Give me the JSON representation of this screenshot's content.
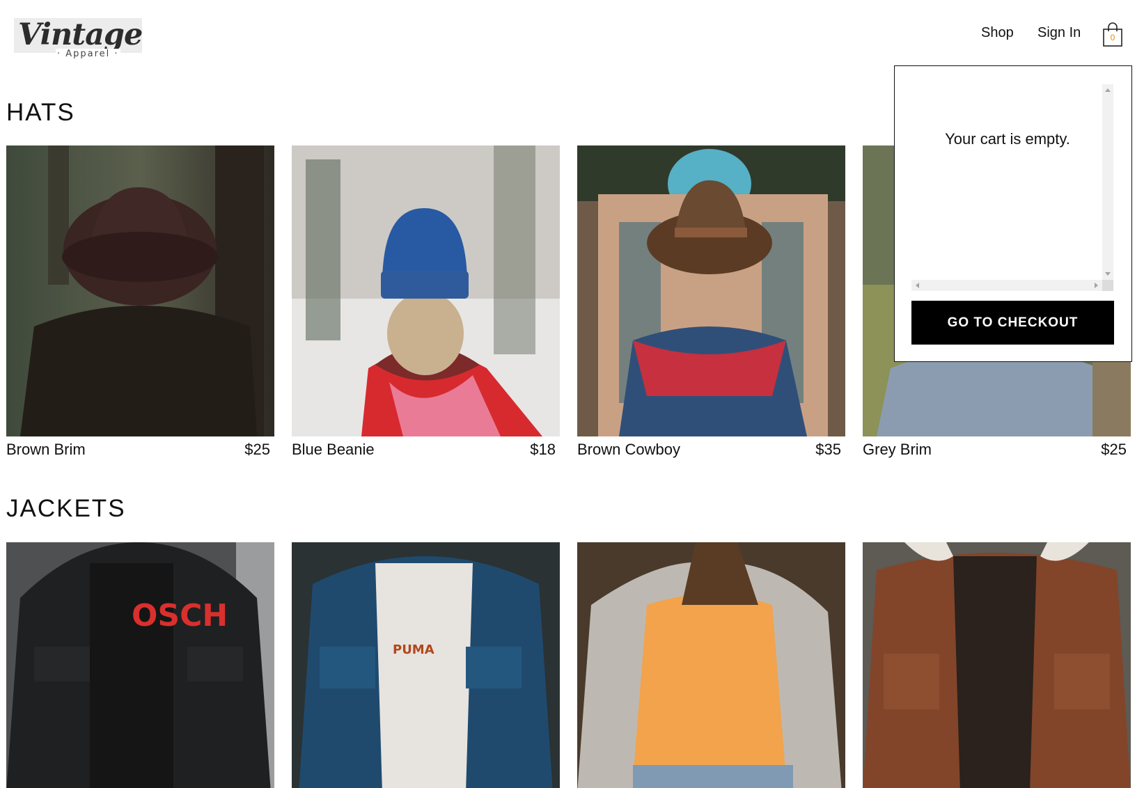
{
  "header": {
    "logo_main": "Vintage",
    "logo_sub": "· Apparel ·",
    "nav": {
      "shop": "Shop",
      "sign_in": "Sign In"
    },
    "cart_count": "0"
  },
  "sections": {
    "hats": {
      "title": "HATS",
      "items": [
        {
          "name": "Brown Brim",
          "price": "$25"
        },
        {
          "name": "Blue Beanie",
          "price": "$18"
        },
        {
          "name": "Brown Cowboy",
          "price": "$35"
        },
        {
          "name": "Grey Brim",
          "price": "$25"
        }
      ]
    },
    "jackets": {
      "title": "JACKETS"
    }
  },
  "cart": {
    "empty_message": "Your cart is empty.",
    "checkout_label": "GO TO CHECKOUT"
  },
  "colors": {
    "accent_cart_count": "#e0910f",
    "button_bg": "#000000",
    "button_text": "#ffffff"
  }
}
